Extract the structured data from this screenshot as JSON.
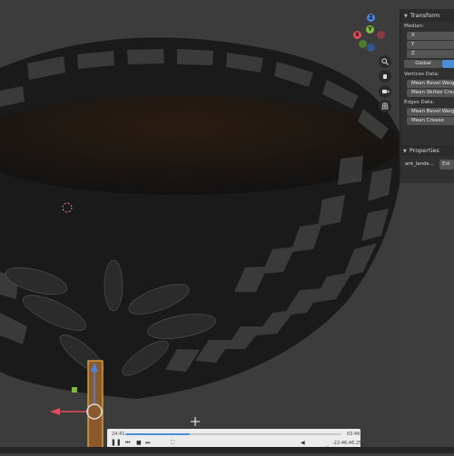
{
  "gizmo": {
    "z_label": "Z",
    "y_label": "Y",
    "x_label": "X"
  },
  "panel": {
    "transform_header": "Transform",
    "median_label": "Median:",
    "fields": [
      "X",
      "Y",
      "Z"
    ],
    "global_label": "Global",
    "vertices_label": "Vertices Data:",
    "vertex_buttons": [
      "Mean Bevel Weight",
      "Mean Vertex Crease"
    ],
    "edges_label": "Edges Data:",
    "edge_buttons": [
      "Mean Bevel Weight",
      "Mean Crease"
    ],
    "properties_header": "Properties",
    "prop_name": "ant_lands...",
    "edit_label": "Edi"
  },
  "player": {
    "current_time": "24:41",
    "remaining_time": "-22:46:46.25",
    "end_time": "03:46",
    "progress": 0.3,
    "volume": 0.7
  },
  "colors": {
    "accent": "#4a8fd6",
    "gizmo_x": "#e14b5a",
    "gizmo_y": "#7fba3a",
    "gizmo_z": "#4a83e0",
    "rim": "#f0b040"
  }
}
